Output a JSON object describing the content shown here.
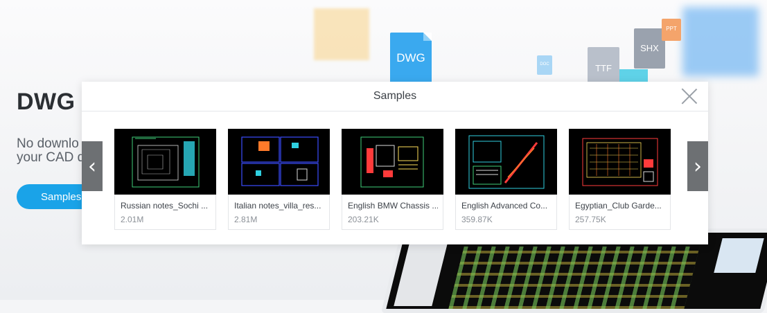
{
  "hero": {
    "title": "DWG",
    "subtitle_line1": "No downlo",
    "subtitle_line2": "your CAD d",
    "button_label": "Samples"
  },
  "floating_icons": {
    "dwg": "DWG",
    "ttf": "TTF",
    "shx": "SHX",
    "ppt": "PPT",
    "doc": "DOC"
  },
  "modal": {
    "title": "Samples",
    "prev_label": "‹",
    "next_label": "›",
    "samples": [
      {
        "name": "Russian notes_Sochi ...",
        "size": "2.01M"
      },
      {
        "name": "Italian notes_villa_res...",
        "size": "2.81M"
      },
      {
        "name": "English BMW Chassis ...",
        "size": "203.21K"
      },
      {
        "name": "English Advanced Co...",
        "size": "359.87K"
      },
      {
        "name": "Egyptian_Club Garde...",
        "size": "257.75K"
      }
    ]
  },
  "colors": {
    "accent": "#1aa3e8",
    "nav_button": "#6d7073"
  }
}
